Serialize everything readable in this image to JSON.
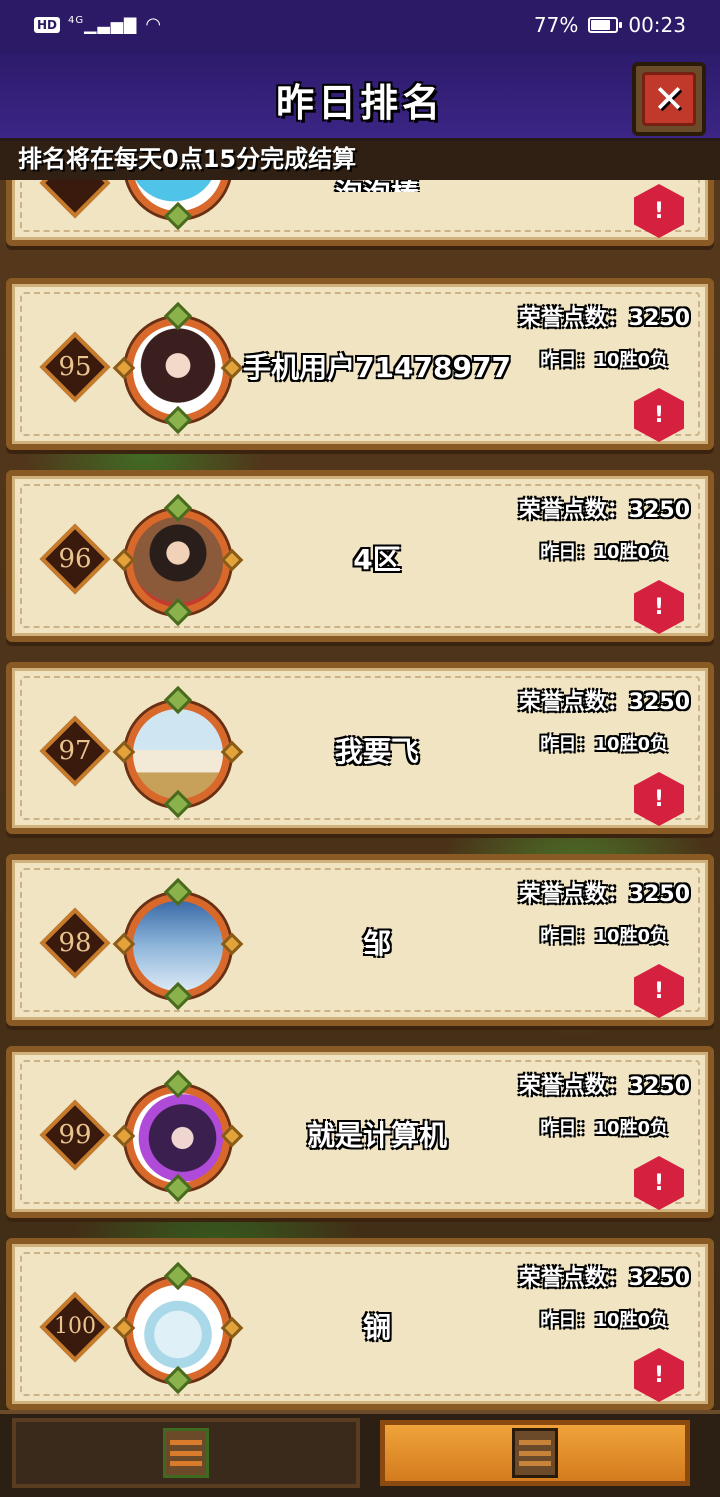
{
  "status_bar": {
    "hd": "HD",
    "network": "4G",
    "battery_percent": "77%",
    "battery_level": 0.77,
    "time": "00:23"
  },
  "header": {
    "title": "昨日排名",
    "close_icon": "close-icon",
    "notice": "排名将在每天0点15分完成结算"
  },
  "partial_top": {
    "name": "泡泡棒",
    "report_icon": "warning-icon"
  },
  "entries": [
    {
      "rank": "95",
      "name": "手机用户71478977",
      "honor": "荣誉点数：3250",
      "yesterday": "昨日：10胜0负"
    },
    {
      "rank": "96",
      "name": "4区",
      "honor": "荣誉点数：3250",
      "yesterday": "昨日：10胜0负"
    },
    {
      "rank": "97",
      "name": "我要飞",
      "honor": "荣誉点数：3250",
      "yesterday": "昨日：10胜0负"
    },
    {
      "rank": "98",
      "name": "邹",
      "honor": "荣誉点数：3250",
      "yesterday": "昨日：10胜0负"
    },
    {
      "rank": "99",
      "name": "就是计算机",
      "honor": "荣誉点数：3250",
      "yesterday": "昨日：10胜0负"
    },
    {
      "rank": "100",
      "name": "锎",
      "honor": "荣誉点数：3250",
      "yesterday": "昨日：10胜0负"
    }
  ],
  "colors": {
    "header_bg": "#2d1b6c",
    "card_bg": "#f1e4c2",
    "card_border": "#8a5a24",
    "report_red": "#d6203f",
    "tab_active": "#f0a33a"
  },
  "bottom_nav": {
    "left_icon": "leaderboard-board-icon",
    "right_icon": "ranking-board-icon",
    "active": "right"
  }
}
